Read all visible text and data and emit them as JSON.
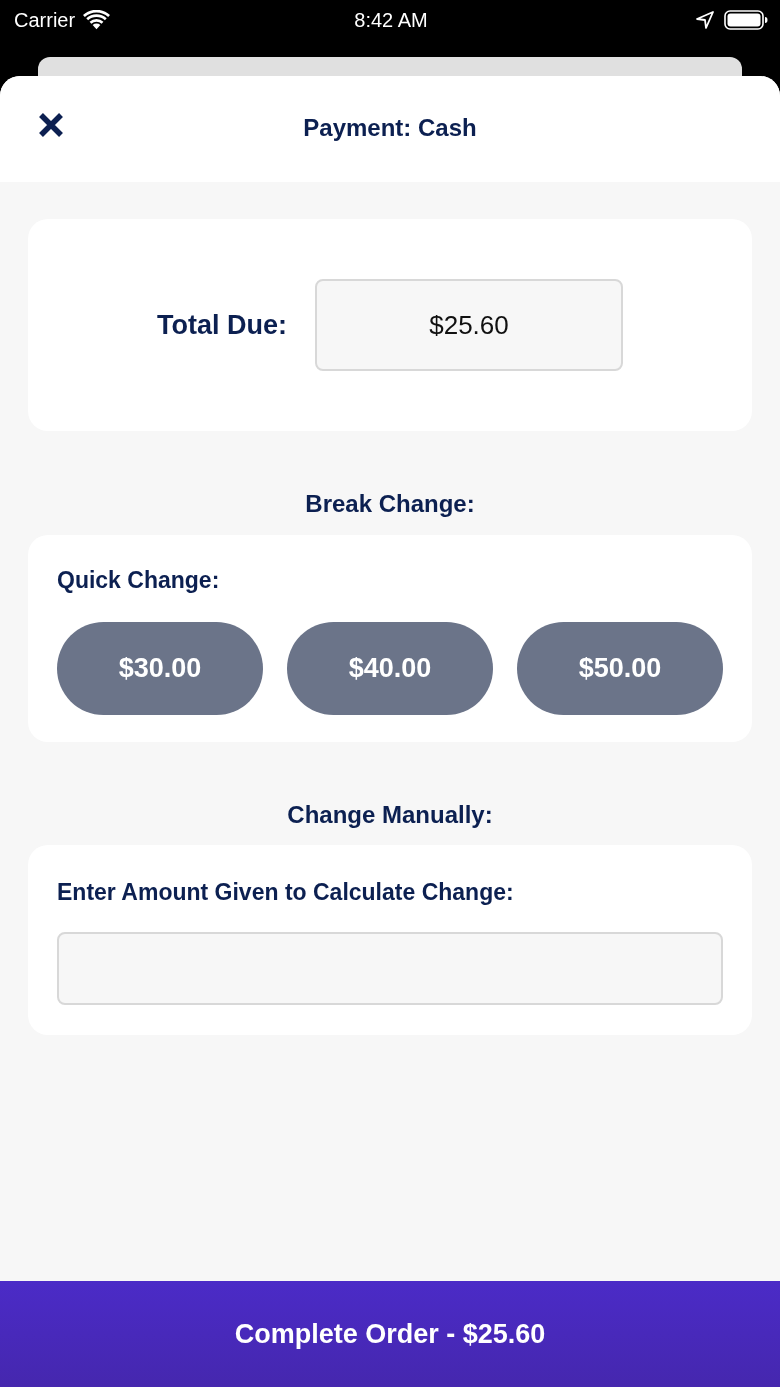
{
  "status_bar": {
    "carrier": "Carrier",
    "time": "8:42 AM"
  },
  "header": {
    "title": "Payment: Cash"
  },
  "total_due": {
    "label": "Total Due:",
    "value": "$25.60"
  },
  "break_change": {
    "heading": "Break Change:",
    "label": "Quick Change:",
    "options": [
      "$30.00",
      "$40.00",
      "$50.00"
    ]
  },
  "manual_change": {
    "heading": "Change Manually:",
    "label": "Enter Amount Given to Calculate Change:"
  },
  "complete_button": {
    "label": "Complete Order - $25.60"
  }
}
